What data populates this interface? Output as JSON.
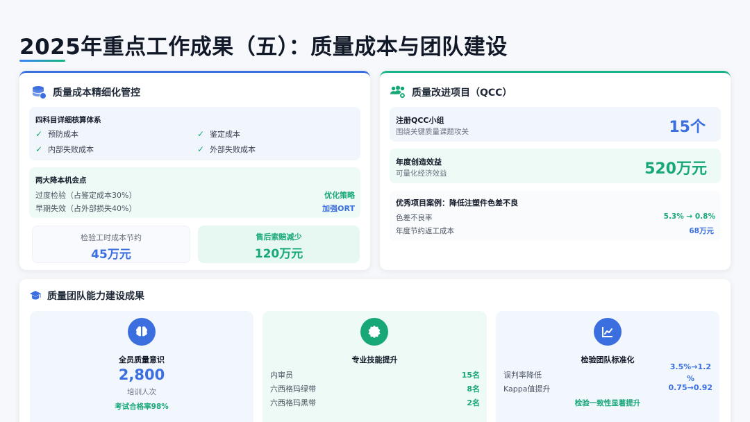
{
  "page": {
    "title": "2025年重点工作成果（五）：质量成本与团队建设"
  },
  "colors": {
    "accent_blue": "#3b6fe0",
    "accent_green": "#18a878"
  },
  "cost_card": {
    "icon": "database-coins-icon",
    "title": "质量成本精细化管控",
    "system_panel": {
      "title": "四科目详细核算体系",
      "items": [
        "预防成本",
        "鉴定成本",
        "内部失败成本",
        "外部失败成本"
      ]
    },
    "opportunity_panel": {
      "title": "两大降本机会点",
      "rows": [
        {
          "text": "过度检验（占鉴定成本30%）",
          "action": "优化策略"
        },
        {
          "text": "早期失效（占外部损失40%）",
          "action": "加强ORT"
        }
      ]
    },
    "stats": [
      {
        "label": "检验工时成本节约",
        "value": "45万元"
      },
      {
        "label": "售后索赔减少",
        "value": "120万元"
      }
    ]
  },
  "qcc_card": {
    "icon": "team-gear-icon",
    "title": "质量改进项目（QCC）",
    "groups": {
      "label": "注册QCC小组",
      "sub": "围绕关键质量课题攻关",
      "value": "15个"
    },
    "benefit": {
      "label": "年度创造效益",
      "sub": "可量化经济效益",
      "value": "520万元"
    },
    "case": {
      "title": "优秀项目案例：降低注塑件色差不良",
      "rows": [
        {
          "label": "色差不良率",
          "value": "5.3% → 0.8%"
        },
        {
          "label": "年度节约返工成本",
          "value": "68万元"
        }
      ]
    }
  },
  "team_section": {
    "icon": "graduation-cap-icon",
    "title": "质量团队能力建设成果",
    "cards": [
      {
        "icon": "brain-icon",
        "title": "全员质量意识",
        "big_value": "2,800",
        "sub": "培训人次",
        "footer": "考试合格率98%"
      },
      {
        "icon": "badge-icon",
        "title": "专业技能提升",
        "rows": [
          {
            "label": "内审员",
            "value": "15名"
          },
          {
            "label": "六西格玛绿带",
            "value": "8名"
          },
          {
            "label": "六西格玛黑带",
            "value": "2名"
          }
        ]
      },
      {
        "icon": "chart-line-icon",
        "title": "检验团队标准化",
        "rows": [
          {
            "label": "误判率降低",
            "value_line1": "3.5%→1.2",
            "value_line2": "%"
          },
          {
            "label": "Kappa值提升",
            "value": "0.75→0.92"
          }
        ],
        "footer": "检验一致性显著提升"
      }
    ]
  }
}
